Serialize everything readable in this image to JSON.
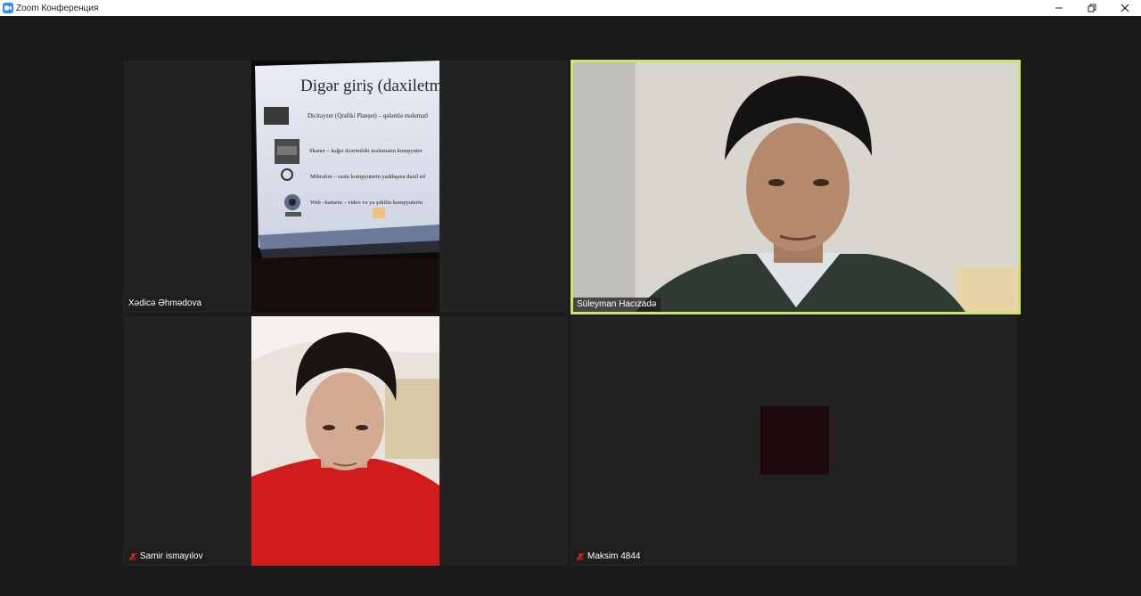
{
  "window": {
    "title": "Zoom Конференция",
    "controls": [
      "minimize",
      "restore",
      "close"
    ]
  },
  "participants": [
    {
      "name": "Xədicə Əhmədova",
      "muted": false,
      "active_speaker": false,
      "video": "screen-slide",
      "slide": {
        "title": "Digər giriş (daxiletm",
        "items": [
          "Dicitayzer (Qrafiki Planşet) – qələmlə məlumatl",
          "Skaner – kağız üzərindəki məlumatın kompyuter",
          "Mikrafon – səsin kompyuterin yaddaşına daxil ed",
          "Web –kamera – video və ya şəkilin kompyuterin"
        ]
      }
    },
    {
      "name": "Süleyman Hacızadə",
      "muted": false,
      "active_speaker": true,
      "video": "camera"
    },
    {
      "name": "Samir ismayılov",
      "muted": true,
      "active_speaker": false,
      "video": "camera"
    },
    {
      "name": "Maksim 4844",
      "muted": true,
      "active_speaker": false,
      "video": "off"
    }
  ],
  "colors": {
    "active_border": "#cde468",
    "mute_icon": "#e02828",
    "background": "#1a1a1a",
    "tile": "#222222"
  }
}
